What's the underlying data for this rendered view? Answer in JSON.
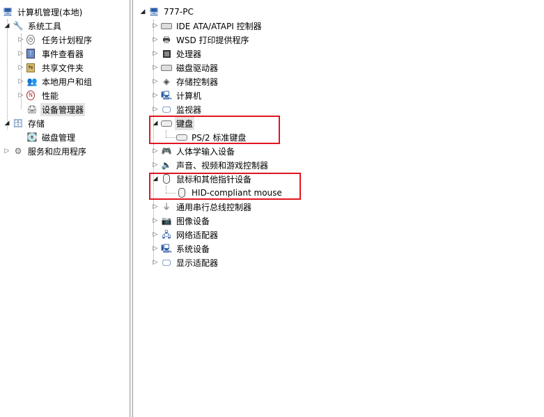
{
  "left_tree": {
    "root": "计算机管理(本地)",
    "system_tools": "系统工具",
    "task_scheduler": "任务计划程序",
    "event_viewer": "事件查看器",
    "shared_folders": "共享文件夹",
    "local_users": "本地用户和组",
    "performance": "性能",
    "device_manager": "设备管理器",
    "storage": "存储",
    "disk_management": "磁盘管理",
    "services_apps": "服务和应用程序"
  },
  "right_tree": {
    "root": "777-PC",
    "ide": "IDE ATA/ATAPI 控制器",
    "wsd": "WSD 打印提供程序",
    "processor": "处理器",
    "disk_drives": "磁盘驱动器",
    "storage_ctrl": "存储控制器",
    "computer": "计算机",
    "monitors": "监视器",
    "keyboards": "键盘",
    "ps2_keyboard": "PS/2 标准键盘",
    "hid": "人体学输入设备",
    "sound": "声音、视频和游戏控制器",
    "mice": "鼠标和其他指针设备",
    "hid_mouse": "HID-compliant mouse",
    "usb": "通用串行总线控制器",
    "imaging": "图像设备",
    "network": "网络适配器",
    "system": "系统设备",
    "display": "显示适配器"
  },
  "icons": {
    "expanded": "expanded-triangle",
    "collapsed": "collapsed-triangle"
  },
  "colors": {
    "highlight_box": "#e0141e",
    "selected_bg": "#e4e4e4"
  }
}
